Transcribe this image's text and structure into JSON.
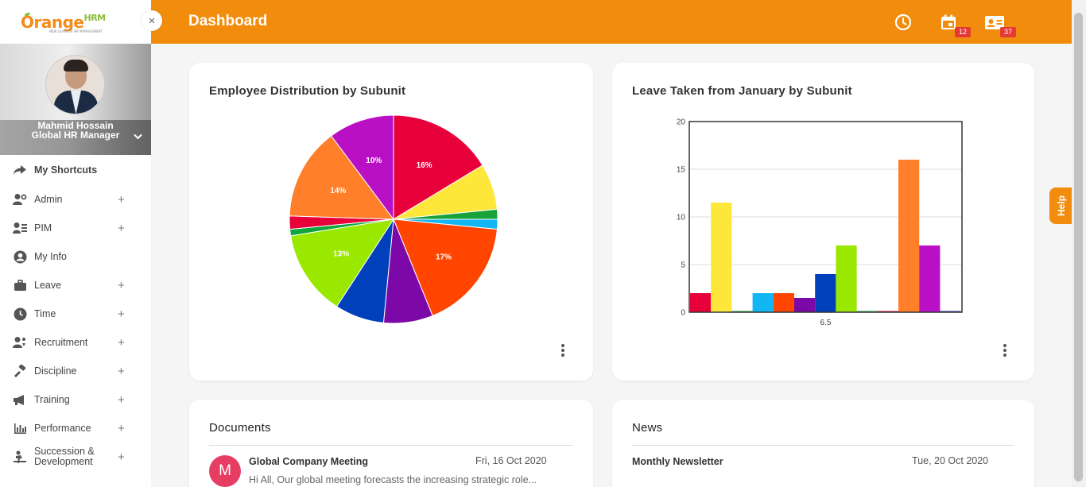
{
  "app": {
    "logo_orange": "Orange",
    "logo_hrm": "HRM",
    "logo_tagline": "NEW LEVEL OF HR MANAGEMENT",
    "close_glyph": "×"
  },
  "profile": {
    "name": "Mahmid Hossain",
    "role": "Global HR Manager"
  },
  "menu": [
    {
      "label": "My Shortcuts",
      "icon": "share-icon",
      "expandable": false
    },
    {
      "label": "Admin",
      "icon": "admin-icon",
      "expandable": true
    },
    {
      "label": "PIM",
      "icon": "pim-icon",
      "expandable": true
    },
    {
      "label": "My Info",
      "icon": "user-circle-icon",
      "expandable": false
    },
    {
      "label": "Leave",
      "icon": "briefcase-icon",
      "expandable": true
    },
    {
      "label": "Time",
      "icon": "clock-icon",
      "expandable": true
    },
    {
      "label": "Recruitment",
      "icon": "recruitment-icon",
      "expandable": true
    },
    {
      "label": "Discipline",
      "icon": "discipline-icon",
      "expandable": true
    },
    {
      "label": "Training",
      "icon": "megaphone-icon",
      "expandable": true
    },
    {
      "label": "Performance",
      "icon": "bar-chart-icon",
      "expandable": true
    },
    {
      "label": "Succession & Development",
      "line1": "Succession &",
      "line2": "Development",
      "icon": "succession-icon",
      "expandable": true
    }
  ],
  "header": {
    "title": "Dashboard",
    "icons": [
      "clock-icon",
      "calendar-icon",
      "contact-card-icon"
    ],
    "calendar_badge": "12",
    "contacts_badge": "37",
    "accent": "#f28c0c"
  },
  "help": {
    "label": "Help"
  },
  "cards": {
    "employee_distribution": {
      "title": "Employee Distribution by Subunit"
    },
    "leave_taken": {
      "title": "Leave Taken from January by Subunit"
    },
    "documents": {
      "title": "Documents",
      "items": [
        {
          "initial": "M",
          "title": "Global Company Meeting",
          "date": "Fri, 16 Oct 2020",
          "excerpt": "Hi All, Our global meeting forecasts the increasing strategic role..."
        }
      ]
    },
    "news": {
      "title": "News",
      "items": [
        {
          "title": "Monthly Newsletter",
          "date": "Tue, 20 Oct 2020"
        }
      ]
    }
  },
  "chart_data": [
    {
      "type": "pie",
      "title": "Employee Distribution by Subunit",
      "slices": [
        {
          "value": 16,
          "color": "#e8003b",
          "label": "16%"
        },
        {
          "value": 7,
          "color": "#fde73a",
          "label": ""
        },
        {
          "value": 1.5,
          "color": "#17a33a",
          "label": ""
        },
        {
          "value": 1.5,
          "color": "#12b6f5",
          "label": ""
        },
        {
          "value": 17,
          "color": "#ff4500",
          "label": "17%"
        },
        {
          "value": 7.5,
          "color": "#7d08a8",
          "label": ""
        },
        {
          "value": 7.5,
          "color": "#0041bb",
          "label": ""
        },
        {
          "value": 13,
          "color": "#9ae700",
          "label": "13%"
        },
        {
          "value": 1,
          "color": "#0da63c",
          "label": ""
        },
        {
          "value": 2,
          "color": "#e8003b",
          "label": ""
        },
        {
          "value": 14,
          "color": "#ff7f2a",
          "label": "14%"
        },
        {
          "value": 10,
          "color": "#b90fc5",
          "label": "10%"
        }
      ]
    },
    {
      "type": "bar",
      "title": "Leave Taken from January by Subunit",
      "categories": [
        "6.5"
      ],
      "ylim": [
        0,
        20
      ],
      "yticks": [
        "20",
        "15",
        "10",
        "5",
        "0"
      ],
      "grid": true,
      "bars": [
        {
          "value": 2,
          "color": "#e8003b"
        },
        {
          "value": 11.5,
          "color": "#fde73a"
        },
        {
          "value": 0,
          "color": "#17a33a"
        },
        {
          "value": 2,
          "color": "#12b6f5"
        },
        {
          "value": 2,
          "color": "#ff4500"
        },
        {
          "value": 1.5,
          "color": "#7d08a8"
        },
        {
          "value": 4,
          "color": "#0041bb"
        },
        {
          "value": 7,
          "color": "#9ae700"
        },
        {
          "value": 0,
          "color": "#0da63c"
        },
        {
          "value": 0,
          "color": "#e8003b"
        },
        {
          "value": 16,
          "color": "#ff7f2a"
        },
        {
          "value": 7,
          "color": "#b90fc5"
        },
        {
          "value": 0,
          "color": "#2a2aa8"
        }
      ]
    }
  ]
}
